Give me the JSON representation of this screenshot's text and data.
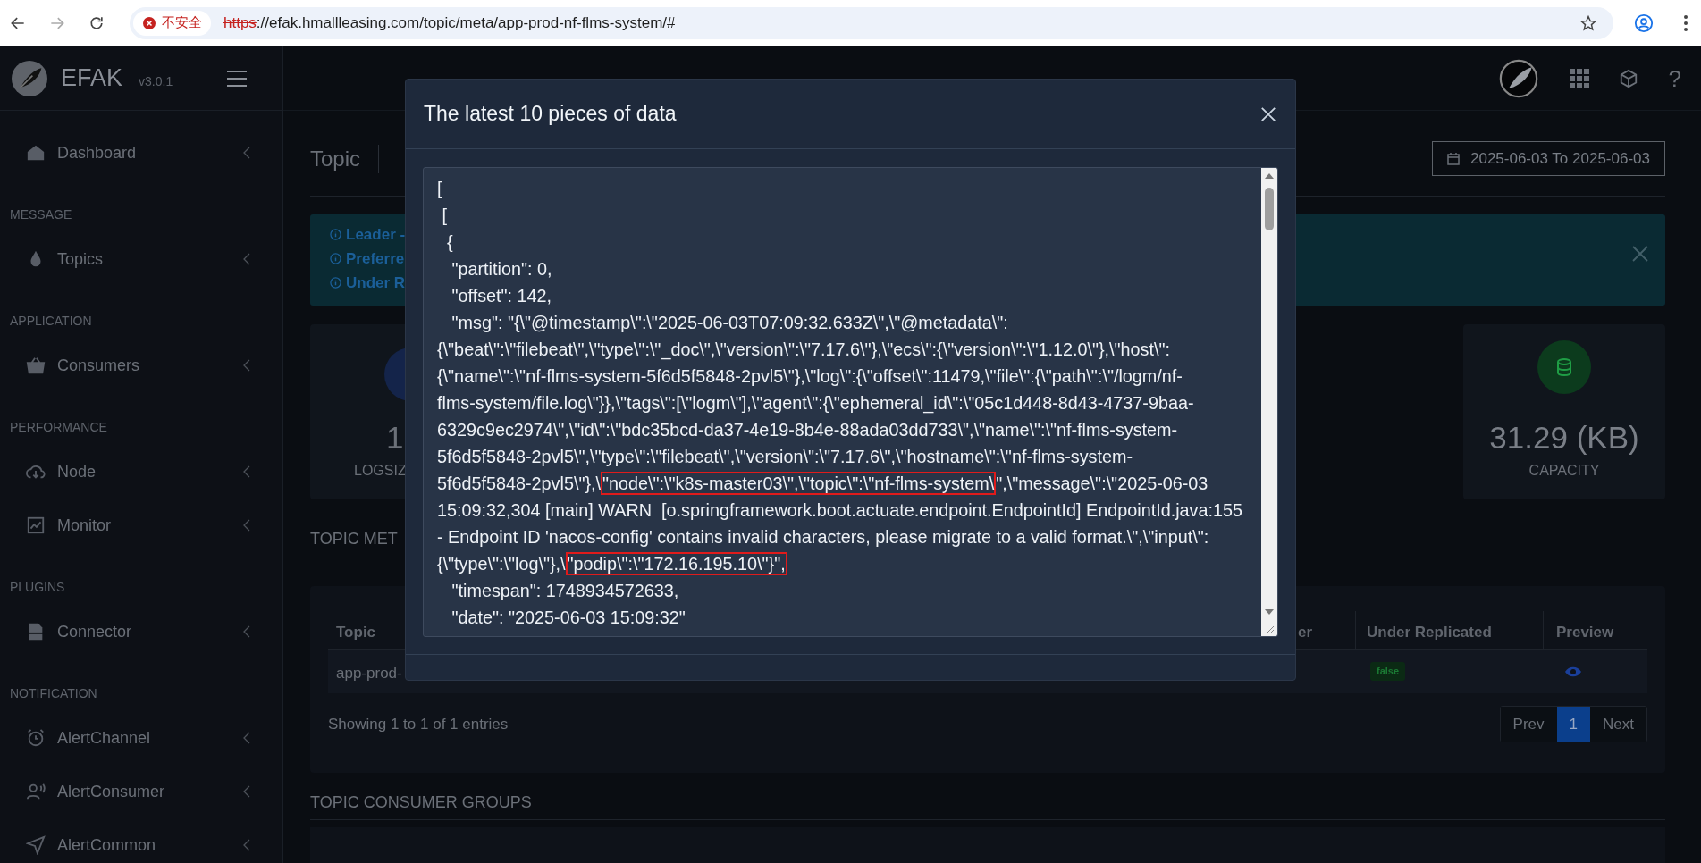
{
  "browser": {
    "security_label": "不安全",
    "url_scheme": "https",
    "url_rest": "://efak.hmallleasing.com/topic/meta/app-prod-nf-flms-system/#"
  },
  "app": {
    "brand": "EFAK",
    "version": "v3.0.1",
    "help_glyph": "?"
  },
  "sidebar": {
    "sections": [
      {
        "items": [
          {
            "label": "Dashboard"
          }
        ]
      },
      {
        "heading": "MESSAGE",
        "items": [
          {
            "label": "Topics"
          }
        ]
      },
      {
        "heading": "APPLICATION",
        "items": [
          {
            "label": "Consumers"
          }
        ]
      },
      {
        "heading": "PERFORMANCE",
        "items": [
          {
            "label": "Node"
          },
          {
            "label": "Monitor"
          }
        ]
      },
      {
        "heading": "PLUGINS",
        "items": [
          {
            "label": "Connector"
          }
        ]
      },
      {
        "heading": "NOTIFICATION",
        "items": [
          {
            "label": "AlertChannel"
          },
          {
            "label": "AlertConsumer"
          },
          {
            "label": "AlertCommon"
          }
        ]
      }
    ]
  },
  "page": {
    "title": "Topic",
    "date_range": "2025-06-03 To 2025-06-03"
  },
  "notice": {
    "lines": [
      "Leader -",
      "Preferre",
      "Under R"
    ]
  },
  "stats": [
    {
      "value": "1",
      "label": "LOGSIZ"
    },
    {
      "value": "31.29 (KB)",
      "label": "CAPACITY"
    }
  ],
  "metadata": {
    "heading": "TOPIC MET",
    "columns": [
      "Topic",
      "er",
      "Under Replicated",
      "Preview"
    ],
    "row": {
      "topic": "app-prod-",
      "under_replicated": "false"
    },
    "summary": "Showing 1 to 1 of 1 entries",
    "pagination": {
      "prev": "Prev",
      "pages": [
        {
          "label": "1",
          "selected": true
        }
      ],
      "next": "Next"
    }
  },
  "consumer_groups": {
    "heading": "TOPIC CONSUMER GROUPS"
  },
  "modal": {
    "title": "The latest 10 pieces of data",
    "lines": [
      {
        "text": "["
      },
      {
        "text": " ["
      },
      {
        "text": "  {"
      },
      {
        "text": "   \"partition\": 0,"
      },
      {
        "text": "   \"offset\": 142,"
      },
      {
        "text": "   \"msg\": \"{\\\"@timestamp\\\":\\\"2025-06-03T07:09:32.633Z\\\",\\\"@metadata\\\":"
      },
      {
        "text": "{\\\"beat\\\":\\\"filebeat\\\",\\\"type\\\":\\\"_doc\\\",\\\"version\\\":\\\"7.17.6\\\"},\\\"ecs\\\":{\\\"version\\\":\\\"1.12.0\\\"},\\\"host\\\":"
      },
      {
        "text": "{\\\"name\\\":\\\"nf-flms-system-5f6d5f5848-2pvl5\\\"},\\\"log\\\":{\\\"offset\\\":11479,\\\"file\\\":{\\\"path\\\":\\\"/logm/nf-"
      },
      {
        "text": "flms-system/file.log\\\"}},\\\"tags\\\":[\\\"logm\\\"],\\\"agent\\\":{\\\"ephemeral_id\\\":\\\"05c1d448-8d43-4737-9baa-"
      },
      {
        "text": "6329c9ec2974\\\",\\\"id\\\":\\\"bdc35bcd-da37-4e19-8b4e-88ada03dd733\\\",\\\"name\\\":\\\"nf-flms-system-"
      },
      {
        "text": "5f6d5f5848-2pvl5\\\",\\\"type\\\":\\\"filebeat\\\",\\\"version\\\":\\\"7.17.6\\\",\\\"hostname\\\":\\\"nf-flms-system-"
      },
      {
        "text": "5f6d5f5848-2pvl5\\\"},\\",
        "highlight": "\"node\\\":\\\"k8s-master03\\\",\\\"topic\\\":\\\"nf-flms-system\\",
        "rest": "\",\\\"message\\\":\\\"2025-06-03"
      },
      {
        "text": "15:09:32,304 [main] WARN  [o.springframework.boot.actuate.endpoint.EndpointId] EndpointId.java:155"
      },
      {
        "text": "- Endpoint ID 'nacos-config' contains invalid characters, please migrate to a valid format.\\\",\\\"input\\\":"
      },
      {
        "text": "{\\\"type\\\":\\\"log\\\"},\\",
        "highlight": "\"podip\\\":\\\"172.16.195.10\\\"}\","
      },
      {
        "text": "   \"timespan\": 1748934572633,"
      },
      {
        "text": "   \"date\": \"2025-06-03 15:09:32\""
      }
    ]
  }
}
